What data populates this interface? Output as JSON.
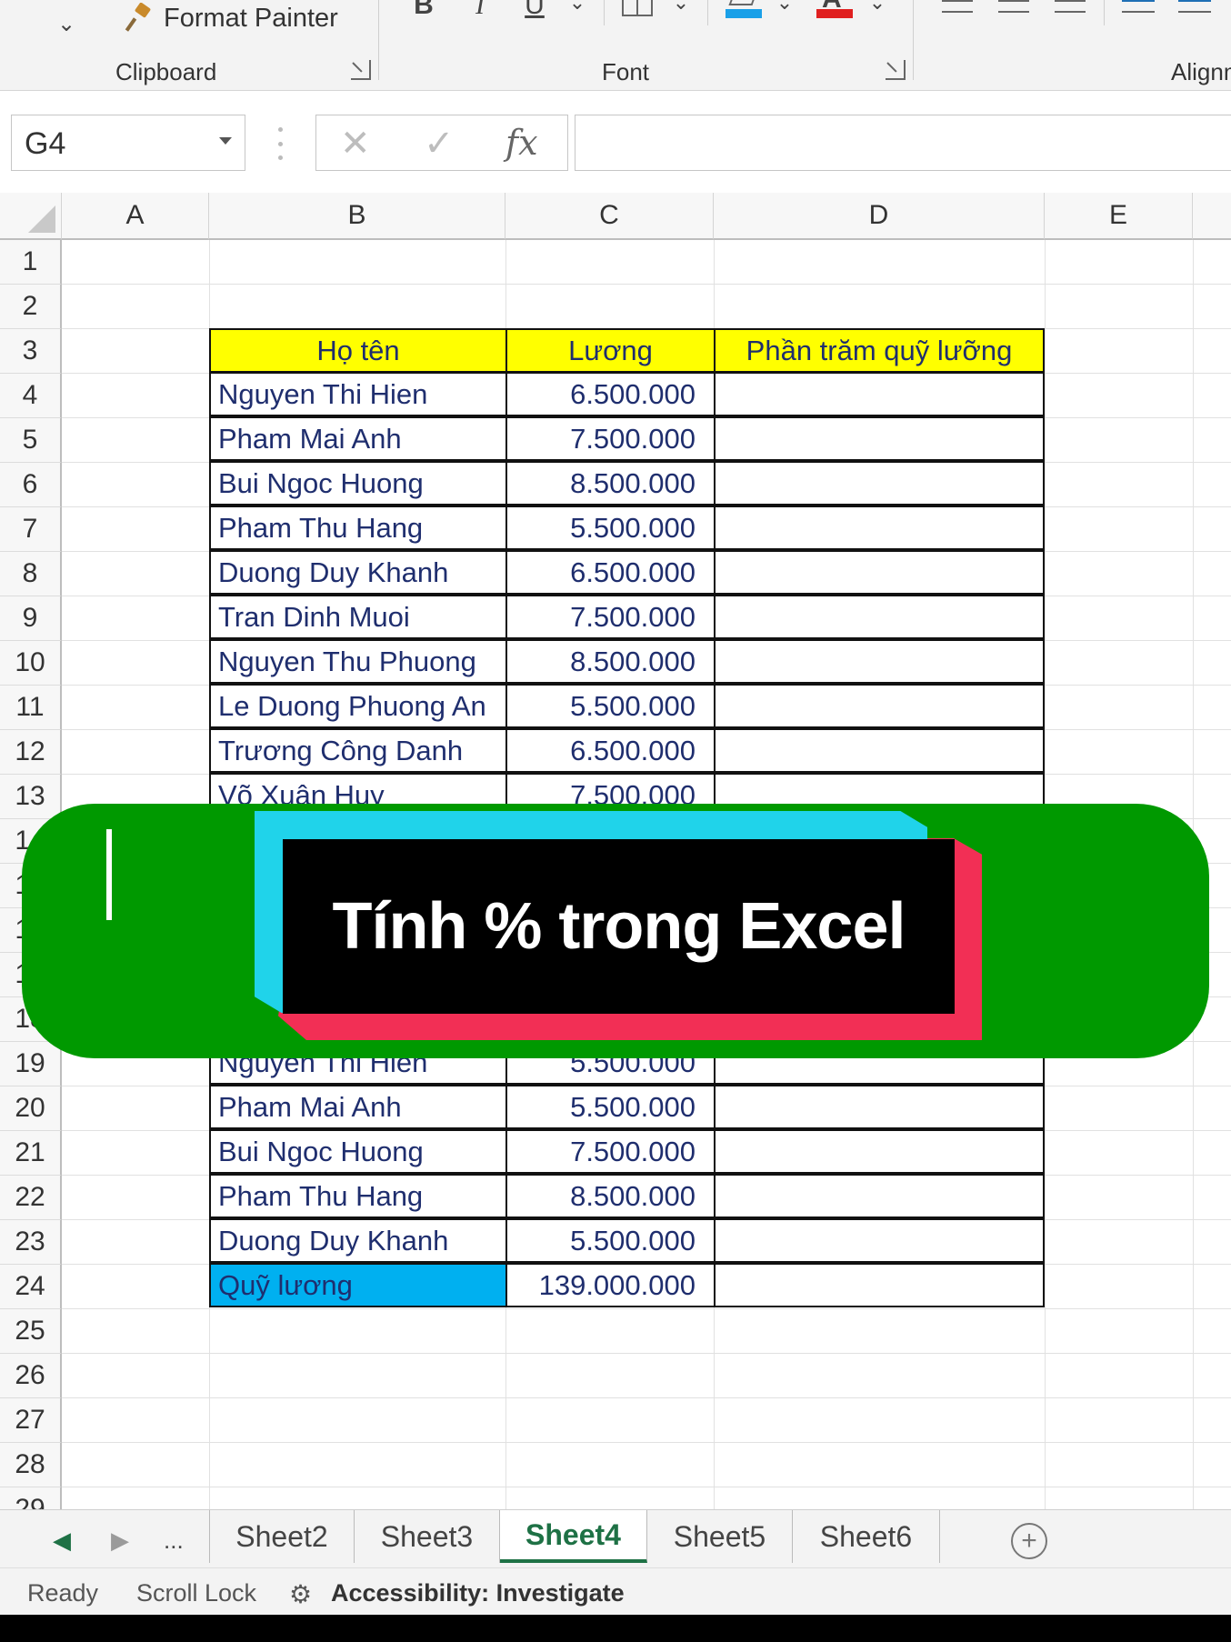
{
  "ribbon": {
    "format_painter_label": "Format Painter",
    "groups": {
      "clipboard": "Clipboard",
      "font": "Font",
      "alignment": "Alignm"
    },
    "font_buttons": {
      "bold": "B",
      "italic": "I",
      "underline": "U"
    },
    "colors": {
      "highlight": "#1aa0e8",
      "font_color": "#e02020"
    }
  },
  "formula_bar": {
    "name_box": "G4",
    "fx_label": "fx",
    "cancel_glyph": "✕",
    "enter_glyph": "✓",
    "formula": ""
  },
  "columns": [
    "A",
    "B",
    "C",
    "D",
    "E"
  ],
  "rows": [
    "1",
    "2",
    "3",
    "4",
    "5",
    "6",
    "7",
    "8",
    "9",
    "10",
    "11",
    "12",
    "13",
    "14",
    "15",
    "16",
    "17",
    "18",
    "19",
    "20",
    "21",
    "22",
    "23",
    "24",
    "25",
    "26",
    "27",
    "28",
    "29"
  ],
  "table": {
    "headers": {
      "name": "Họ tên",
      "salary": "Lương",
      "percent": "Phần trăm quỹ lưỡng"
    },
    "rows": [
      {
        "row": "4",
        "name": "Nguyen Thi Hien",
        "salary": "6.500.000"
      },
      {
        "row": "5",
        "name": "Pham Mai Anh",
        "salary": "7.500.000"
      },
      {
        "row": "6",
        "name": "Bui Ngoc Huong",
        "salary": "8.500.000"
      },
      {
        "row": "7",
        "name": "Pham Thu Hang",
        "salary": "5.500.000"
      },
      {
        "row": "8",
        "name": "Duong Duy Khanh",
        "salary": "6.500.000"
      },
      {
        "row": "9",
        "name": "Tran Dinh Muoi",
        "salary": "7.500.000"
      },
      {
        "row": "10",
        "name": "Nguyen Thu Phuong",
        "salary": "8.500.000"
      },
      {
        "row": "11",
        "name": "Le Duong Phuong An",
        "salary": "5.500.000"
      },
      {
        "row": "12",
        "name": "Trương Công Danh",
        "salary": "6.500.000"
      },
      {
        "row": "13",
        "name": "Võ Xuân Huy",
        "salary": "7.500.000"
      },
      {
        "row": "19",
        "name": "Nguyen Thi Hien",
        "salary": "5.500.000"
      },
      {
        "row": "20",
        "name": "Pham Mai Anh",
        "salary": "5.500.000"
      },
      {
        "row": "21",
        "name": "Bui Ngoc Huong",
        "salary": "7.500.000"
      },
      {
        "row": "22",
        "name": "Pham Thu Hang",
        "salary": "8.500.000"
      },
      {
        "row": "23",
        "name": "Duong Duy Khanh",
        "salary": "5.500.000"
      }
    ],
    "total": {
      "label": "Quỹ lương",
      "value": "139.000.000"
    },
    "colors": {
      "header_fill": "#ffff00",
      "total_fill": "#00b0f0"
    }
  },
  "banner": {
    "title": "Tính % trong Excel",
    "colors": {
      "background": "#009900",
      "cyan": "#20d3ea",
      "red": "#f22f55",
      "box": "#000000"
    }
  },
  "sheet_tabs": {
    "ellipsis": "...",
    "tabs": [
      "Sheet2",
      "Sheet3",
      "Sheet4",
      "Sheet5",
      "Sheet6"
    ],
    "active": "Sheet4",
    "add_glyph": "+"
  },
  "status_bar": {
    "ready": "Ready",
    "scroll_lock": "Scroll Lock",
    "accessibility": "Accessibility: Investigate"
  }
}
